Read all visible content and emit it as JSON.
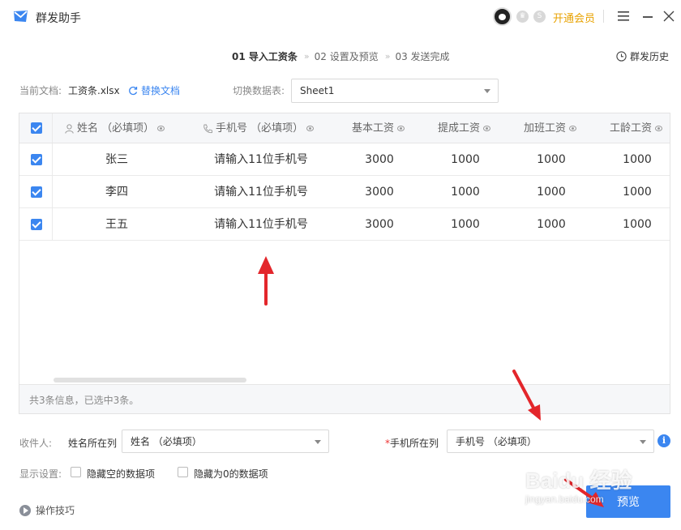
{
  "app": {
    "title": "群发助手"
  },
  "titlebar": {
    "vip_label": "开通会员",
    "badge_s": "S",
    "icons": [
      "mail-logo-icon",
      "avatar",
      "vip-badge-icon",
      "s-badge-icon",
      "menu-icon",
      "minimize-icon",
      "close-icon"
    ]
  },
  "steps": [
    {
      "label": "01 导入工资条",
      "active": true
    },
    {
      "label": "02 设置及预览",
      "active": false
    },
    {
      "label": "03 发送完成",
      "active": false
    }
  ],
  "history_label": "群发历史",
  "document": {
    "current_label": "当前文档:",
    "file_name": "工资条.xlsx",
    "replace_label": "替换文档",
    "switch_label": "切换数据表:",
    "sheet_value": "Sheet1"
  },
  "table": {
    "columns": [
      "姓名 （必填项）",
      "手机号 （必填项）",
      "基本工资",
      "提成工资",
      "加班工资",
      "工龄工资"
    ],
    "rows": [
      {
        "checked": true,
        "cells": [
          "张三",
          "请输入11位手机号",
          "3000",
          "1000",
          "1000",
          "1000"
        ]
      },
      {
        "checked": true,
        "cells": [
          "李四",
          "请输入11位手机号",
          "3000",
          "1000",
          "1000",
          "1000"
        ]
      },
      {
        "checked": true,
        "cells": [
          "王五",
          "请输入11位手机号",
          "3000",
          "1000",
          "1000",
          "1000"
        ]
      }
    ],
    "footer": "共3条信息，已选中3条。"
  },
  "recipient": {
    "label": "收件人:",
    "name_col_label": "姓名所在列",
    "name_col_value": "姓名 （必填项）",
    "phone_col_required": "*",
    "phone_col_label": "手机所在列",
    "phone_col_value": "手机号 （必填项）",
    "info": "i"
  },
  "display": {
    "label": "显示设置:",
    "hide_empty": "隐藏空的数据项",
    "hide_zero": "隐藏为0的数据项"
  },
  "tips_label": "操作技巧",
  "preview_label": "预览",
  "watermark": {
    "brand": "Baidu 经验",
    "url": "jingyan.baidu.com"
  },
  "colors": {
    "accent": "#3b86f0",
    "vip": "#e8a200",
    "annotation": "#e3262b"
  }
}
